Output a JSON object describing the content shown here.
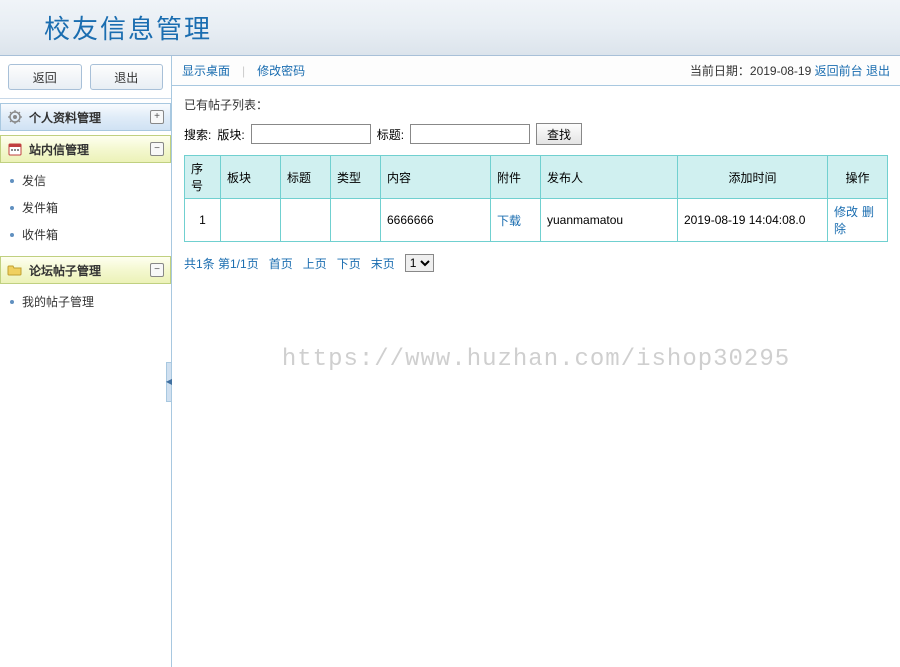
{
  "header": {
    "title": "校友信息管理"
  },
  "sidebar": {
    "back_label": "返回",
    "exit_label": "退出",
    "panels": [
      {
        "title": "个人资料管理",
        "icon": "gear-icon",
        "expanded": false,
        "toggle": "+",
        "items": []
      },
      {
        "title": "站内信管理",
        "icon": "calendar-icon",
        "expanded": true,
        "toggle": "−",
        "items": [
          {
            "label": "发信"
          },
          {
            "label": "发件箱"
          },
          {
            "label": "收件箱"
          }
        ]
      },
      {
        "title": "论坛帖子管理",
        "icon": "folder-icon",
        "expanded": true,
        "toggle": "−",
        "items": [
          {
            "label": "我的帖子管理"
          }
        ]
      }
    ]
  },
  "topbar": {
    "show_desktop": "显示桌面",
    "change_password": "修改密码",
    "current_date_label": "当前日期：",
    "current_date": "2019-08-19",
    "back_front": "返回前台",
    "logout": "退出"
  },
  "content": {
    "list_title": "已有帖子列表：",
    "search_label": "搜索:",
    "field_section_label": "版块:",
    "field_title_label": "标题:",
    "section_value": "",
    "title_value": "",
    "search_btn": "查找"
  },
  "table": {
    "headers": [
      "序号",
      "板块",
      "标题",
      "类型",
      "内容",
      "附件",
      "发布人",
      "添加时间",
      "操作"
    ],
    "rows": [
      {
        "index": "1",
        "section": "",
        "title": "",
        "type": "",
        "content": "6666666",
        "attachment": "下载",
        "publisher": "yuanmamatou",
        "add_time": "2019-08-19 14:04:08.0",
        "op_edit": "修改",
        "op_delete": "删除"
      }
    ]
  },
  "pager": {
    "info": "共1条 第1/1页",
    "first": "首页",
    "prev": "上页",
    "next": "下页",
    "last": "末页",
    "page_options": [
      "1"
    ],
    "page_selected": "1"
  },
  "watermark": "https://www.huzhan.com/ishop30295"
}
